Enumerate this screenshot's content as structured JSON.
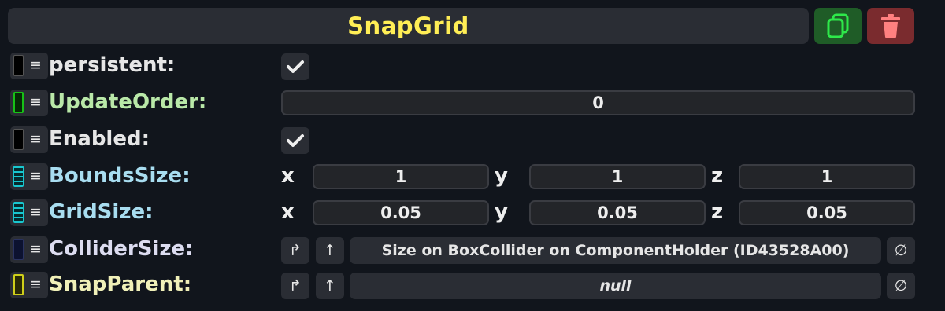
{
  "header": {
    "title": "SnapGrid",
    "duplicate_icon": "copy-icon",
    "delete_icon": "trash-icon",
    "title_color": "#ffee55"
  },
  "fields": [
    {
      "label": "persistent:",
      "label_color": "#e6e6e6",
      "swatch": "#000000",
      "type": "checkbox",
      "checked": true
    },
    {
      "label": "UpdateOrder:",
      "label_color": "#b9e8a8",
      "swatch": "#17c117",
      "type": "int",
      "value": "0"
    },
    {
      "label": "Enabled:",
      "label_color": "#e6e6e6",
      "swatch": "#000000",
      "type": "checkbox",
      "checked": true
    },
    {
      "label": "BoundsSize:",
      "label_color": "#a8ddf0",
      "swatch": "#19c7cf",
      "type": "vector3",
      "axes": [
        "x",
        "y",
        "z"
      ],
      "values": [
        "1",
        "1",
        "1"
      ]
    },
    {
      "label": "GridSize:",
      "label_color": "#a8ddf0",
      "swatch": "#19c7cf",
      "type": "vector3",
      "axes": [
        "x",
        "y",
        "z"
      ],
      "values": [
        "0.05",
        "0.05",
        "0.05"
      ]
    },
    {
      "label": "ColliderSize:",
      "label_color": "#dcdcf0",
      "swatch": "#0c1230",
      "type": "reference",
      "value": "Size on BoxCollider on ComponentHolder (ID43528A00)"
    },
    {
      "label": "SnapParent:",
      "label_color": "#f0f0b8",
      "swatch": "#cfcf1a",
      "type": "reference",
      "value": "null"
    }
  ],
  "icons": {
    "jump": "↱",
    "open": "↑",
    "clear": "∅"
  }
}
